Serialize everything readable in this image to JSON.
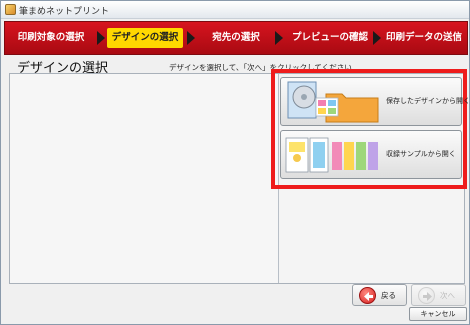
{
  "window": {
    "title": "筆まめネットプリント"
  },
  "steps": [
    {
      "label": "印刷対象の選択",
      "active": false
    },
    {
      "label": "デザインの選択",
      "active": true
    },
    {
      "label": "宛先の選択",
      "active": false
    },
    {
      "label": "プレビューの確認",
      "active": false
    },
    {
      "label": "印刷データの送信",
      "active": false
    }
  ],
  "page": {
    "title": "デザインの選択",
    "instruction": "デザインを選択して、「次へ」をクリックしてください"
  },
  "options": {
    "saved_design": "保存したデザインから開く",
    "sample": "収録サンプルから開く"
  },
  "nav": {
    "back": "戻る",
    "next": "次へ",
    "cancel": "キャンセル"
  },
  "colors": {
    "step_bar": "#c8101a",
    "step_active": "#ffd800",
    "highlight": "#ee1c1c"
  }
}
